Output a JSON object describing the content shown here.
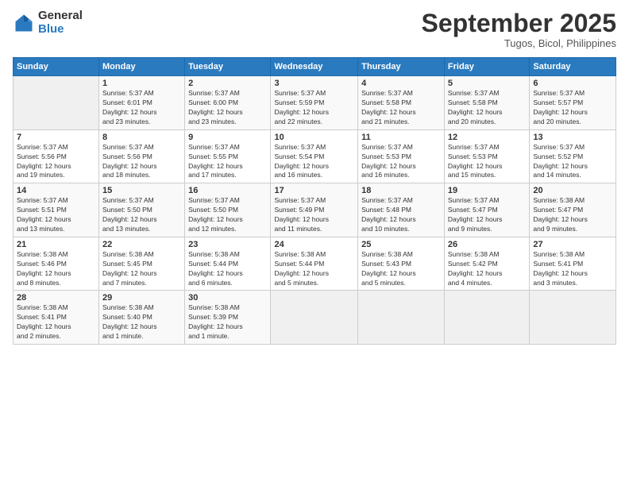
{
  "logo": {
    "general": "General",
    "blue": "Blue"
  },
  "title": "September 2025",
  "subtitle": "Tugos, Bicol, Philippines",
  "days_of_week": [
    "Sunday",
    "Monday",
    "Tuesday",
    "Wednesday",
    "Thursday",
    "Friday",
    "Saturday"
  ],
  "weeks": [
    [
      {
        "day": "",
        "info": ""
      },
      {
        "day": "1",
        "info": "Sunrise: 5:37 AM\nSunset: 6:01 PM\nDaylight: 12 hours\nand 23 minutes."
      },
      {
        "day": "2",
        "info": "Sunrise: 5:37 AM\nSunset: 6:00 PM\nDaylight: 12 hours\nand 23 minutes."
      },
      {
        "day": "3",
        "info": "Sunrise: 5:37 AM\nSunset: 5:59 PM\nDaylight: 12 hours\nand 22 minutes."
      },
      {
        "day": "4",
        "info": "Sunrise: 5:37 AM\nSunset: 5:58 PM\nDaylight: 12 hours\nand 21 minutes."
      },
      {
        "day": "5",
        "info": "Sunrise: 5:37 AM\nSunset: 5:58 PM\nDaylight: 12 hours\nand 20 minutes."
      },
      {
        "day": "6",
        "info": "Sunrise: 5:37 AM\nSunset: 5:57 PM\nDaylight: 12 hours\nand 20 minutes."
      }
    ],
    [
      {
        "day": "7",
        "info": "Sunrise: 5:37 AM\nSunset: 5:56 PM\nDaylight: 12 hours\nand 19 minutes."
      },
      {
        "day": "8",
        "info": "Sunrise: 5:37 AM\nSunset: 5:56 PM\nDaylight: 12 hours\nand 18 minutes."
      },
      {
        "day": "9",
        "info": "Sunrise: 5:37 AM\nSunset: 5:55 PM\nDaylight: 12 hours\nand 17 minutes."
      },
      {
        "day": "10",
        "info": "Sunrise: 5:37 AM\nSunset: 5:54 PM\nDaylight: 12 hours\nand 16 minutes."
      },
      {
        "day": "11",
        "info": "Sunrise: 5:37 AM\nSunset: 5:53 PM\nDaylight: 12 hours\nand 16 minutes."
      },
      {
        "day": "12",
        "info": "Sunrise: 5:37 AM\nSunset: 5:53 PM\nDaylight: 12 hours\nand 15 minutes."
      },
      {
        "day": "13",
        "info": "Sunrise: 5:37 AM\nSunset: 5:52 PM\nDaylight: 12 hours\nand 14 minutes."
      }
    ],
    [
      {
        "day": "14",
        "info": "Sunrise: 5:37 AM\nSunset: 5:51 PM\nDaylight: 12 hours\nand 13 minutes."
      },
      {
        "day": "15",
        "info": "Sunrise: 5:37 AM\nSunset: 5:50 PM\nDaylight: 12 hours\nand 13 minutes."
      },
      {
        "day": "16",
        "info": "Sunrise: 5:37 AM\nSunset: 5:50 PM\nDaylight: 12 hours\nand 12 minutes."
      },
      {
        "day": "17",
        "info": "Sunrise: 5:37 AM\nSunset: 5:49 PM\nDaylight: 12 hours\nand 11 minutes."
      },
      {
        "day": "18",
        "info": "Sunrise: 5:37 AM\nSunset: 5:48 PM\nDaylight: 12 hours\nand 10 minutes."
      },
      {
        "day": "19",
        "info": "Sunrise: 5:37 AM\nSunset: 5:47 PM\nDaylight: 12 hours\nand 9 minutes."
      },
      {
        "day": "20",
        "info": "Sunrise: 5:38 AM\nSunset: 5:47 PM\nDaylight: 12 hours\nand 9 minutes."
      }
    ],
    [
      {
        "day": "21",
        "info": "Sunrise: 5:38 AM\nSunset: 5:46 PM\nDaylight: 12 hours\nand 8 minutes."
      },
      {
        "day": "22",
        "info": "Sunrise: 5:38 AM\nSunset: 5:45 PM\nDaylight: 12 hours\nand 7 minutes."
      },
      {
        "day": "23",
        "info": "Sunrise: 5:38 AM\nSunset: 5:44 PM\nDaylight: 12 hours\nand 6 minutes."
      },
      {
        "day": "24",
        "info": "Sunrise: 5:38 AM\nSunset: 5:44 PM\nDaylight: 12 hours\nand 5 minutes."
      },
      {
        "day": "25",
        "info": "Sunrise: 5:38 AM\nSunset: 5:43 PM\nDaylight: 12 hours\nand 5 minutes."
      },
      {
        "day": "26",
        "info": "Sunrise: 5:38 AM\nSunset: 5:42 PM\nDaylight: 12 hours\nand 4 minutes."
      },
      {
        "day": "27",
        "info": "Sunrise: 5:38 AM\nSunset: 5:41 PM\nDaylight: 12 hours\nand 3 minutes."
      }
    ],
    [
      {
        "day": "28",
        "info": "Sunrise: 5:38 AM\nSunset: 5:41 PM\nDaylight: 12 hours\nand 2 minutes."
      },
      {
        "day": "29",
        "info": "Sunrise: 5:38 AM\nSunset: 5:40 PM\nDaylight: 12 hours\nand 1 minute."
      },
      {
        "day": "30",
        "info": "Sunrise: 5:38 AM\nSunset: 5:39 PM\nDaylight: 12 hours\nand 1 minute."
      },
      {
        "day": "",
        "info": ""
      },
      {
        "day": "",
        "info": ""
      },
      {
        "day": "",
        "info": ""
      },
      {
        "day": "",
        "info": ""
      }
    ]
  ]
}
